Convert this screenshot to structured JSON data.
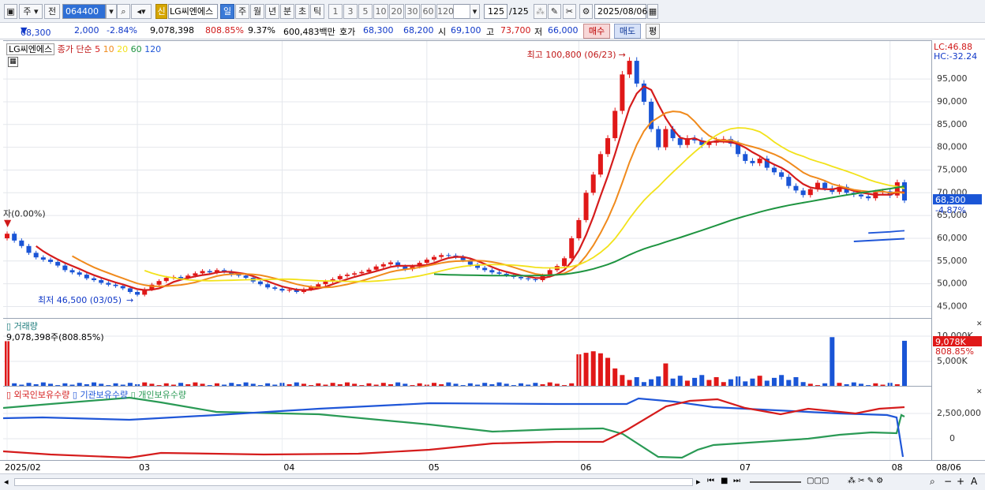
{
  "toolbar": {
    "type_selector": "주",
    "market_selector": "전",
    "stock_code": "064400",
    "new_badge": "신",
    "stock_name": "LG씨엔에스",
    "periods": [
      "일",
      "주",
      "월",
      "년",
      "분",
      "초",
      "틱"
    ],
    "selected_period": "일",
    "intervals": [
      "1",
      "3",
      "5",
      "10",
      "20",
      "30",
      "60",
      "120"
    ],
    "count": "125",
    "count_total": "/125",
    "date": "2025/08/06"
  },
  "quote": {
    "price": "68,300",
    "change": "2,000",
    "change_pct": "-2.84%",
    "volume": "9,078,398",
    "volume_ratio": "808.85%",
    "turnover_pct": "9.37%",
    "trade_value": "600,483백만",
    "bid_label": "호가",
    "ask_price": "68,300",
    "bid_price": "68,200",
    "open_label": "시",
    "open": "69,100",
    "high_label": "고",
    "high": "73,700",
    "low_label": "저",
    "low": "66,000",
    "buy_button": "매수",
    "sell_button": "매도",
    "avg_button": "평"
  },
  "price_pane": {
    "stock_label": "LG씨엔에스",
    "legend_title": "종가 단순",
    "ma_periods": [
      "5",
      "10",
      "20",
      "60",
      "120"
    ],
    "ma_colors": [
      "#d51c1c",
      "#f08a1c",
      "#f2e21a",
      "#1e9440",
      "#1f56d8"
    ],
    "lc_label": "LC:46.88",
    "hc_label": "HC:-32.24",
    "high_annotation": "최고 100,800 (06/23)",
    "low_annotation": "최저 46,500 (03/05)",
    "start_annotation": "자(0.00%)",
    "current_price_tag": "68,300",
    "current_pct_tag": "-4.87%",
    "y_ticks": [
      "95,000",
      "90,000",
      "85,000",
      "80,000",
      "75,000",
      "70,000",
      "65,000",
      "60,000",
      "55,000",
      "50,000",
      "45,000"
    ]
  },
  "volume_pane": {
    "title": "거래량",
    "info": "9,078,398주(808.85%)",
    "tag_value": "9,078K",
    "tag_pct": "808.85%",
    "y_ticks": [
      "10,000K",
      "5,000K"
    ]
  },
  "holding_pane": {
    "legend": [
      "외국인보유수량",
      "기관보유수량",
      "개인보유수량"
    ],
    "legend_colors": [
      "#d51c1c",
      "#1f56d8",
      "#2a9a55"
    ],
    "y_ticks": [
      "2,500,000",
      "0"
    ]
  },
  "x_axis": {
    "labels": [
      "2025/02",
      "03",
      "04",
      "05",
      "06",
      "07",
      "08"
    ],
    "end_label": "08/06"
  },
  "chart_data": {
    "type": "candlestick",
    "title": "",
    "ylim": [
      43000,
      103000
    ],
    "closes": [
      61000,
      59500,
      58300,
      56800,
      55800,
      55300,
      54800,
      54000,
      53000,
      52500,
      52000,
      51200,
      50800,
      50200,
      49800,
      49500,
      49000,
      48200,
      47600,
      48800,
      49800,
      50600,
      51300,
      51500,
      51200,
      51800,
      52300,
      52800,
      52500,
      53000,
      52700,
      52000,
      51800,
      51300,
      50500,
      49900,
      49200,
      48900,
      48500,
      48700,
      48200,
      48800,
      49300,
      49900,
      50500,
      51000,
      51700,
      52000,
      52300,
      52600,
      53100,
      53800,
      54300,
      54700,
      53800,
      53200,
      53800,
      54600,
      55300,
      55900,
      56300,
      56200,
      55900,
      55200,
      54200,
      53500,
      53000,
      52500,
      52200,
      51900,
      51500,
      51200,
      51000,
      50800,
      51800,
      53000,
      53900,
      55600,
      60000,
      64000,
      70000,
      74000,
      78500,
      82000,
      88000,
      96000,
      99000,
      94000,
      90000,
      84000,
      80000,
      84000,
      82000,
      80500,
      82000,
      81500,
      80500,
      81000,
      81500,
      81800,
      80800,
      78500,
      77000,
      76500,
      77500,
      75500,
      74500,
      73500,
      71500,
      70500,
      69500,
      70800,
      72200,
      71000,
      70200,
      71300,
      70000,
      69600,
      69200,
      68800,
      70100,
      70300,
      69400,
      72300,
      68300
    ]
  }
}
